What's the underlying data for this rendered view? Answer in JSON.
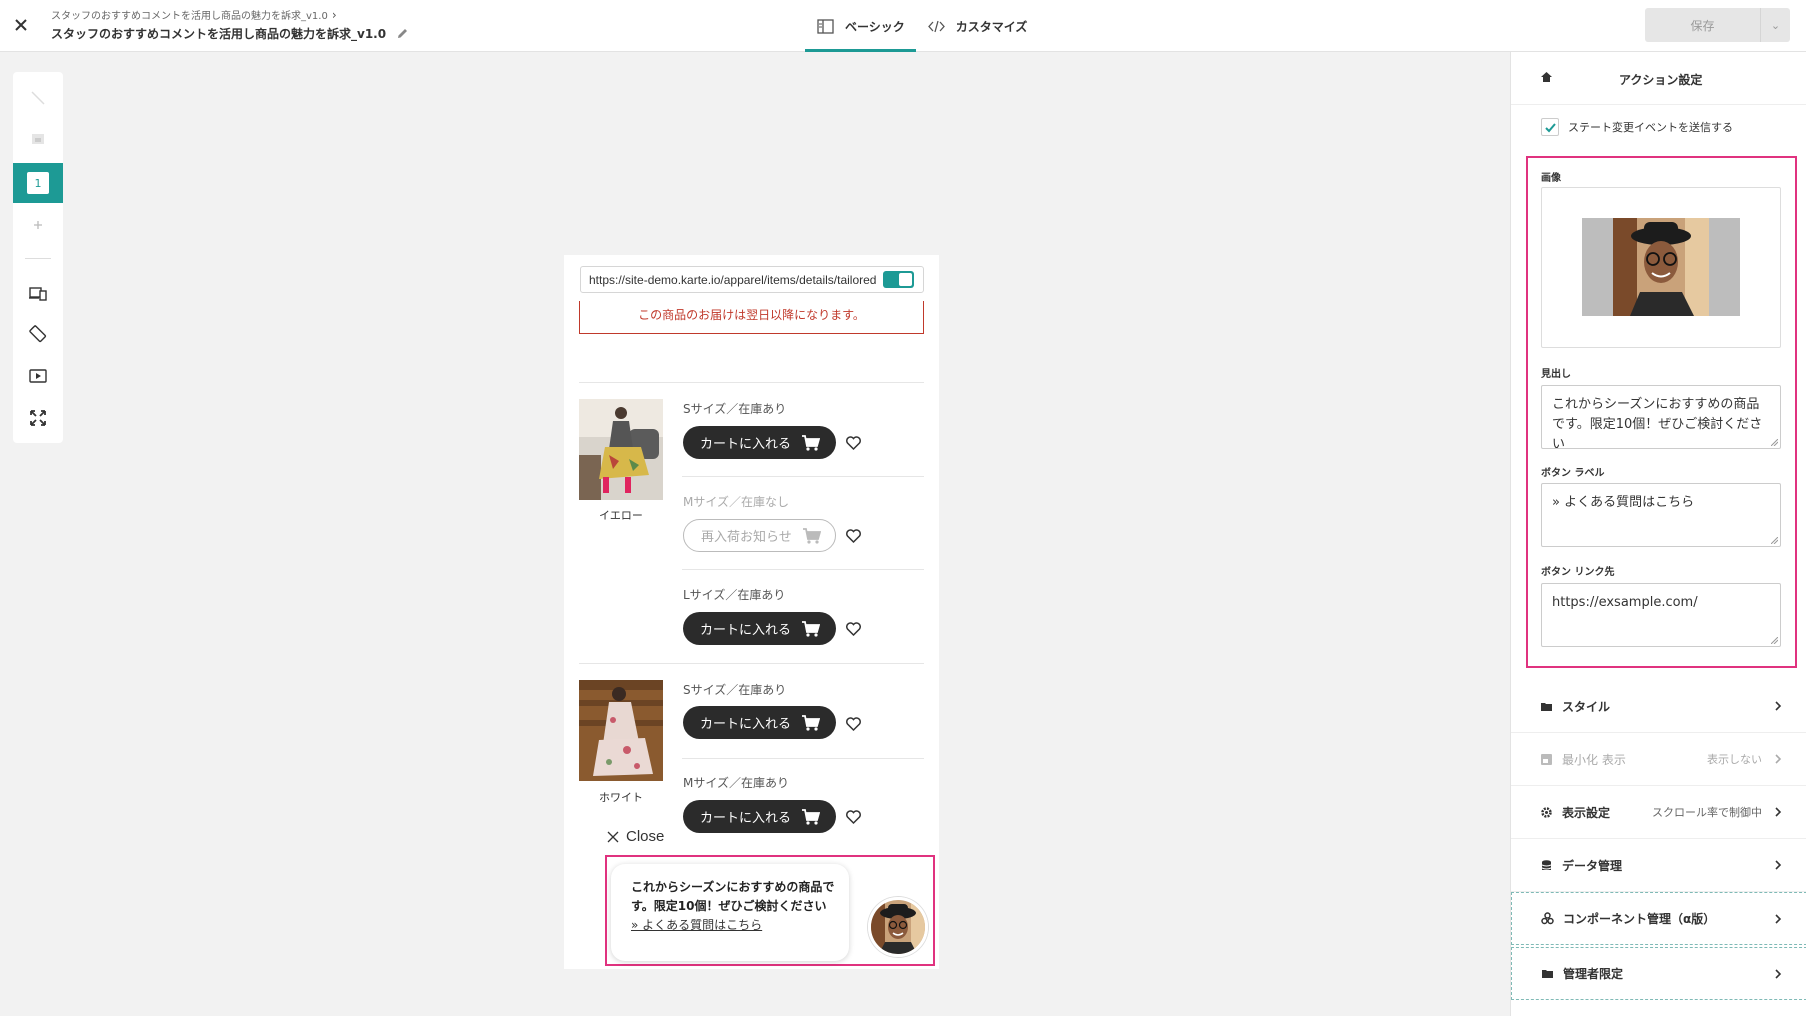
{
  "header": {
    "breadcrumb": "スタッフのおすすめコメントを活用し商品の魅力を訴求_v1.0",
    "title": "スタッフのおすすめコメントを活用し商品の魅力を訴求_v1.0",
    "tabs": [
      {
        "label": "ベーシック",
        "icon": "layout-icon",
        "active": true
      },
      {
        "label": "カスタマイズ",
        "icon": "code-icon",
        "active": false
      }
    ],
    "save_label": "保存"
  },
  "left_toolbar": {
    "items": [
      "line-tool-icon",
      "image-tool-icon",
      "step-1",
      "add-icon",
      "device-icon",
      "rotate-icon",
      "play-icon",
      "fullscreen-icon"
    ],
    "active_step": "1"
  },
  "preview": {
    "url": "https://site-demo.karte.io/apparel/items/details/tailored",
    "notice": "この商品のお届けは翌日以降になります。",
    "products": [
      {
        "color": "イエロー",
        "variants": [
          {
            "size": "Sサイズ／在庫あり",
            "button": "カートに入れる",
            "in_stock": true
          },
          {
            "size": "Mサイズ／在庫なし",
            "button": "再入荷お知らせ",
            "in_stock": false
          },
          {
            "size": "Lサイズ／在庫あり",
            "button": "カートに入れる",
            "in_stock": true
          }
        ]
      },
      {
        "color": "ホワイト",
        "variants": [
          {
            "size": "Sサイズ／在庫あり",
            "button": "カートに入れる",
            "in_stock": true
          },
          {
            "size": "Mサイズ／在庫あり",
            "button": "カートに入れる",
            "in_stock": true
          }
        ]
      }
    ],
    "close_label": "Close",
    "popup": {
      "message": "これからシーズンにおすすめの商品です。限定10個！ぜひご検討ください",
      "link": "» よくある質問はこちら"
    }
  },
  "panel": {
    "title": "アクション設定",
    "state_event_label": "ステート変更イベントを送信する",
    "state_event_checked": true,
    "image_label": "画像",
    "heading_label": "見出し",
    "heading_value": "これからシーズンにおすすめの商品です。限定10個！ぜひご検討ください",
    "button_label_label": "ボタン ラベル",
    "button_label_value": "» よくある質問はこちら",
    "button_link_label": "ボタン リンク先",
    "button_link_value": "https://exsample.com/",
    "sections": [
      {
        "label": "スタイル",
        "value": "",
        "icon": "folder-icon",
        "disabled": false
      },
      {
        "label": "最小化 表示",
        "value": "表示しない",
        "icon": "minimize-icon",
        "disabled": true
      },
      {
        "label": "表示設定",
        "value": "スクロール率で制御中",
        "icon": "gear-icon",
        "disabled": false
      },
      {
        "label": "データ管理",
        "value": "",
        "icon": "database-icon",
        "disabled": false
      },
      {
        "label": "コンポーネント管理（α版）",
        "value": "",
        "icon": "component-icon",
        "disabled": false
      },
      {
        "label": "管理者限定",
        "value": "",
        "icon": "folder-icon",
        "disabled": false
      }
    ]
  },
  "colors": {
    "accent": "#1d9a95",
    "highlight": "#e0327f",
    "notice": "#c0392b"
  }
}
